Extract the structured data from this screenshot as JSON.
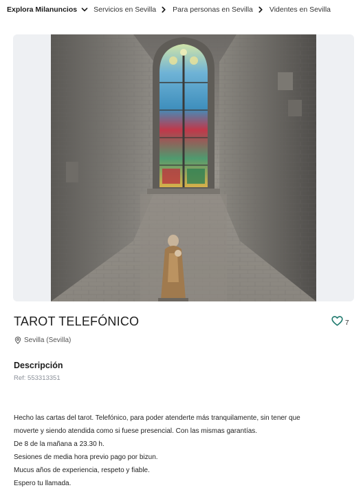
{
  "breadcrumb": {
    "root": "Explora Milanuncios",
    "items": [
      "Servicios en Sevilla",
      "Para personas en Sevilla",
      "Videntes en Sevilla"
    ]
  },
  "listing": {
    "title": "TAROT TELEFÓNICO",
    "favorites_count": "7",
    "location": "Sevilla (Sevilla)",
    "description_heading": "Descripción",
    "ref": "Ref: 553313351",
    "description_lines": [
      "Hecho las cartas del tarot. Telefónico, para poder atenderte más tranquilamente, sin tener que",
      "moverte y siendo atendida como si fuese presencial. Con las mismas garantías.",
      "De 8 de la mañana a 23.30 h.",
      "Sesiones de media hora previo pago por bizun.",
      "Mucus años de experiencia, respeto y fiable.",
      "Espero tu llamada."
    ]
  },
  "icons": {
    "breadcrumb_separator": "chevron-right-icon",
    "breadcrumb_root": "chevron-down-icon",
    "favorite": "heart-icon",
    "location": "location-pin-icon"
  },
  "colors": {
    "accent": "#1f7a6e",
    "photo_background": "#eef0f3",
    "ref_text": "#8a8f98"
  }
}
